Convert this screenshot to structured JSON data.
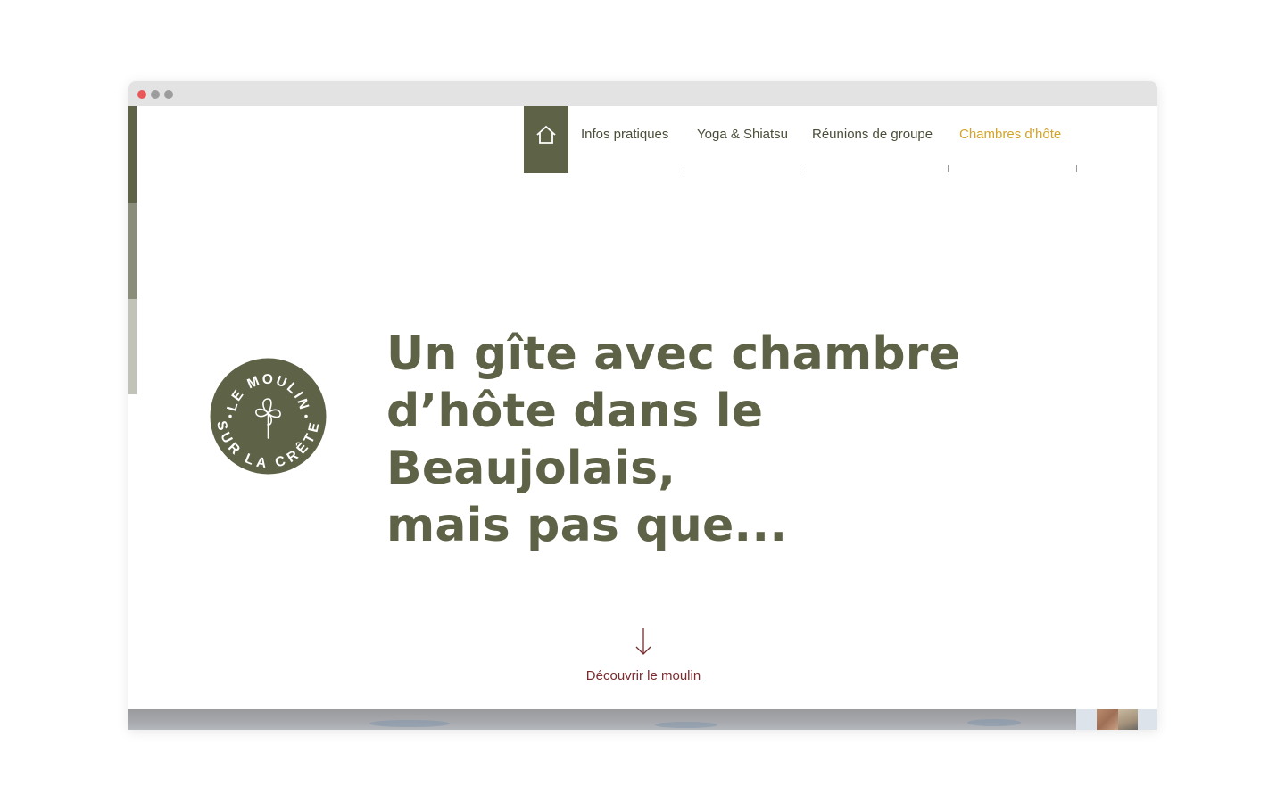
{
  "nav": {
    "home_icon": "house-icon",
    "items": [
      {
        "label": "Infos pratiques",
        "active": false
      },
      {
        "label": "Yoga & Shiatsu",
        "active": false
      },
      {
        "label": "Réunions de groupe",
        "active": false
      },
      {
        "label": "Chambres d’hôte",
        "active": true
      }
    ]
  },
  "logo": {
    "text_top": "LE MOULIN",
    "text_bottom": "SUR LA CRÊTE",
    "icon": "pinwheel-icon"
  },
  "hero": {
    "title_line1": "Un gîte avec chambre",
    "title_line2": "d’hôte dans le Beaujolais,",
    "title_line3": "mais pas que..."
  },
  "cta": {
    "icon": "arrow-down-icon",
    "label": "Découvrir le moulin"
  },
  "colors": {
    "brand_olive": "#5e6246",
    "accent_gold": "#d4a32a",
    "link_burgundy": "#7a2b2e"
  }
}
